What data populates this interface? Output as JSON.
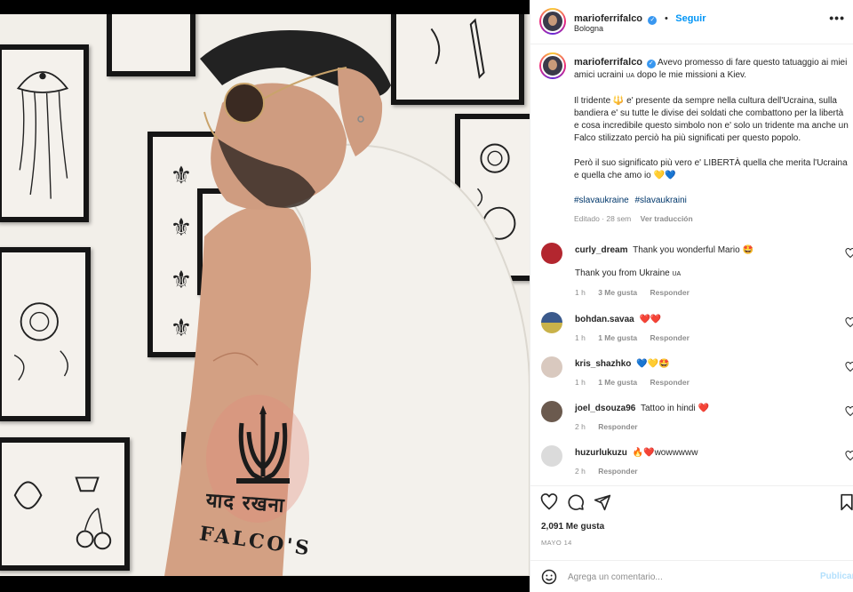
{
  "post": {
    "username": "marioferrifalco",
    "follow_label": "Seguir",
    "location": "Bologna",
    "more_label": "•••",
    "separator": "•",
    "tattoo_script": "याद रखना",
    "tattoo_name": "FALCO'S"
  },
  "caption": {
    "username": "marioferrifalco",
    "para1_a": "Avevo promesso di fare questo tatuaggio ai miei amici ucraini",
    "para1_flag": "UA",
    "para1_b": "dopo le mie missioni a Kiev.",
    "para2_a": "Il tridente",
    "para2_b": "e' presente da sempre nella cultura dell'Ucraina, sulla bandiera e' su tutte le divise dei soldati che combattono per la libertà e cosa incredibile questo simbolo non e' solo un tridente ma anche un Falco stilizzato perciò ha più significati per questo popolo.",
    "para3": "Però il suo significato più vero e' LIBERTÀ quella che merita l'Ucraina e quella che amo io",
    "para3_emoji": "💛💙",
    "hashtags": [
      "#slavaukraine",
      "#slavaukraini"
    ],
    "edited": "Editado · 28 sem",
    "see_translation": "Ver traducción"
  },
  "comments": [
    {
      "user": "curly_dream",
      "text": "Thank you wonderful Mario",
      "emoji": "🤩",
      "time": "",
      "likes": "",
      "reply": "",
      "avatar_color": "#b3262f"
    },
    {
      "user": "",
      "text": "Thank you from Ukraine",
      "flag": "UA",
      "time": "1 h",
      "likes": "3 Me gusta",
      "reply": "Responder",
      "avatar_color": ""
    },
    {
      "user": "bohdan.savaa",
      "text": "",
      "emoji": "❤️❤️",
      "time": "1 h",
      "likes": "1 Me gusta",
      "reply": "Responder",
      "avatar_color": "#3b5a8c"
    },
    {
      "user": "kris_shazhko",
      "text": "",
      "emoji": "💙💛🤩",
      "time": "1 h",
      "likes": "1 Me gusta",
      "reply": "Responder",
      "avatar_color": "#d9c9bf"
    },
    {
      "user": "joel_dsouza96",
      "text": "Tattoo in hindi",
      "emoji": "❤️",
      "time": "2 h",
      "likes": "",
      "reply": "Responder",
      "avatar_color": "#6b5a4e"
    },
    {
      "user": "huzurlukuzu",
      "text": "wowwwww",
      "emoji": "🔥❤️",
      "time": "2 h",
      "likes": "",
      "reply": "Responder",
      "avatar_color": "#dbdbdb"
    }
  ],
  "footer": {
    "likes_count": "2,091 Me gusta",
    "date": "MAYO 14",
    "comment_placeholder": "Agrega un comentario...",
    "publish_label": "Publicar"
  },
  "colors": {
    "accent": "#0095f6",
    "hashtag": "#00376b",
    "muted": "#8e8e8e",
    "heart": "#ed4956"
  }
}
